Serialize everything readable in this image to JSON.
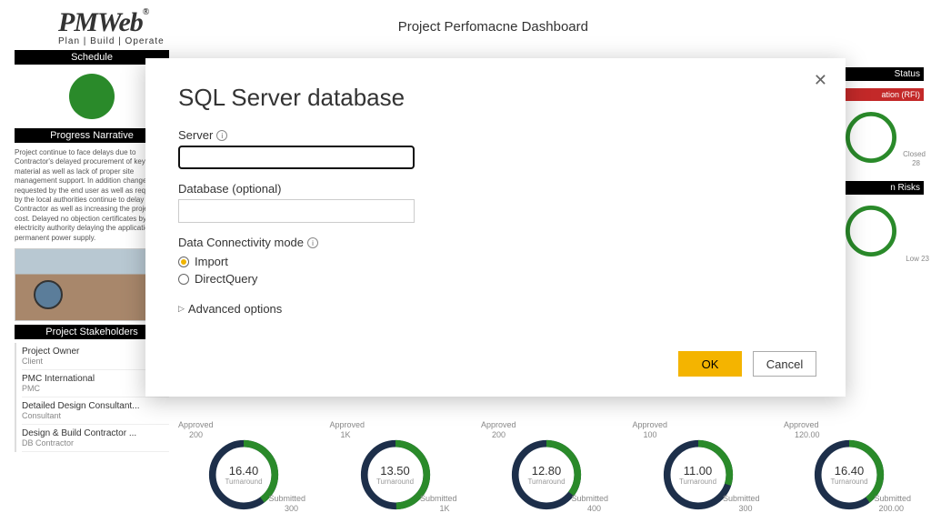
{
  "header": {
    "logo_main": "PM",
    "logo_italic": "Web",
    "tagline": "Plan | Build | Operate",
    "page_title": "Project Perfomacne Dashboard"
  },
  "schedule": {
    "header": "Schedule"
  },
  "narrative": {
    "header": "Progress Narrative",
    "text": "Project continue to face delays due to Contractor's delayed procurement of key material as well as lack of proper site management support. In addition changes requested by the end user as well as requested by the local authorities continue to delay the Contractor as well as increasing the project cost. Delayed no objection certificates by the electricity authority delaying the application for permanent power supply."
  },
  "stakeholders": {
    "header": "Project Stakeholders",
    "rows": [
      {
        "main": "Project Owner",
        "sub": "Client"
      },
      {
        "main": "PMC International",
        "sub": "PMC"
      },
      {
        "main": "Detailed Design Consultant...",
        "sub": "Consultant"
      },
      {
        "main": "Design & Build Contractor ...",
        "sub": "DB Contractor"
      }
    ]
  },
  "right": {
    "status_hdr": "Status",
    "rfi_hdr": "ation (RFI)",
    "rfi_closed_label": "Closed",
    "rfi_closed_val": "28",
    "risk_hdr": "n Risks",
    "risk_low_label": "Low 23"
  },
  "gauges": [
    {
      "approved": "200",
      "submitted": "300",
      "val": "16.40",
      "sub": "Turnaround"
    },
    {
      "approved": "1K",
      "submitted": "1K",
      "val": "13.50",
      "sub": "Turnaround"
    },
    {
      "approved": "200",
      "submitted": "400",
      "val": "12.80",
      "sub": "Turnaround"
    },
    {
      "approved": "100",
      "submitted": "300",
      "val": "11.00",
      "sub": "Turnaround"
    },
    {
      "approved": "120.00",
      "submitted": "200.00",
      "val": "16.40",
      "sub": "Turnaround"
    }
  ],
  "gauge_labels": {
    "approved": "Approved",
    "submitted": "Submitted"
  },
  "modal": {
    "title": "SQL Server database",
    "server_label": "Server",
    "database_label": "Database (optional)",
    "conn_label": "Data Connectivity mode",
    "opt_import": "Import",
    "opt_direct": "DirectQuery",
    "advanced": "Advanced options",
    "ok": "OK",
    "cancel": "Cancel",
    "server_value": ""
  },
  "pct": {
    "g0": 40,
    "g1": 50,
    "g2": 35,
    "g3": 30,
    "g4": 40
  }
}
